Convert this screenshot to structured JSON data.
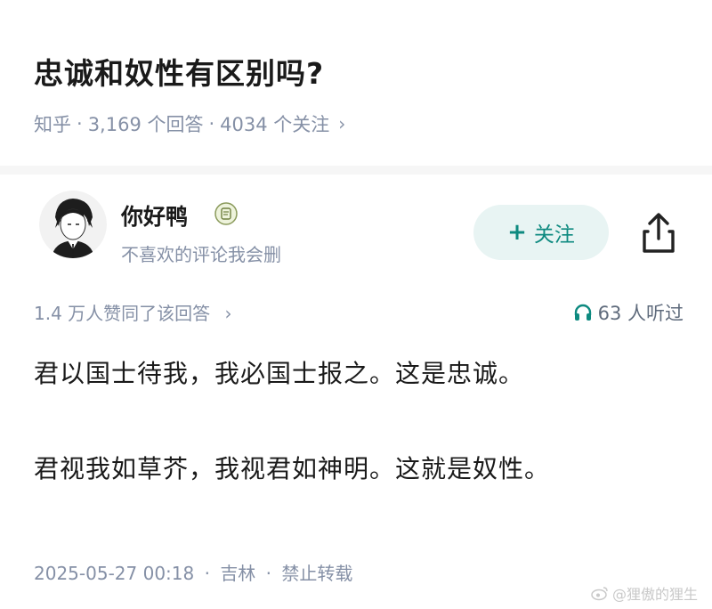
{
  "question": {
    "title": "忠诚和奴性有区别吗?",
    "source": "知乎",
    "answers_count": "3,169 个回答",
    "followers_count": "4034 个关注",
    "chevron": "›"
  },
  "author": {
    "name": "你好鸭",
    "bio": "不喜欢的评论我会删",
    "badge_icon": "badge-icon",
    "avatar_icon": "avatar-anime-boy"
  },
  "actions": {
    "follow_plus": "+",
    "follow_label": "关注",
    "share_icon": "share-icon"
  },
  "stats": {
    "likes": "1.4 万人赞同了该回答",
    "chevron": "›",
    "listens": "63 人听过",
    "listen_icon": "headphones-icon"
  },
  "answer": {
    "paragraphs": [
      "君以国士待我，我必国士报之。这是忠诚。",
      "君视我如草芥，我视君如神明。这就是奴性。"
    ]
  },
  "footer": {
    "date": "2025-05-27 00:18",
    "location": "吉林",
    "copyright": "禁止转载",
    "separator": "·"
  },
  "watermark": {
    "text": "@狸傲的狸生",
    "icon": "weibo-icon"
  },
  "colors": {
    "accent": "#0e8a80",
    "accent_bg": "#e8f4f3",
    "meta_gray": "#8590a6",
    "text": "#1a1a1a"
  }
}
